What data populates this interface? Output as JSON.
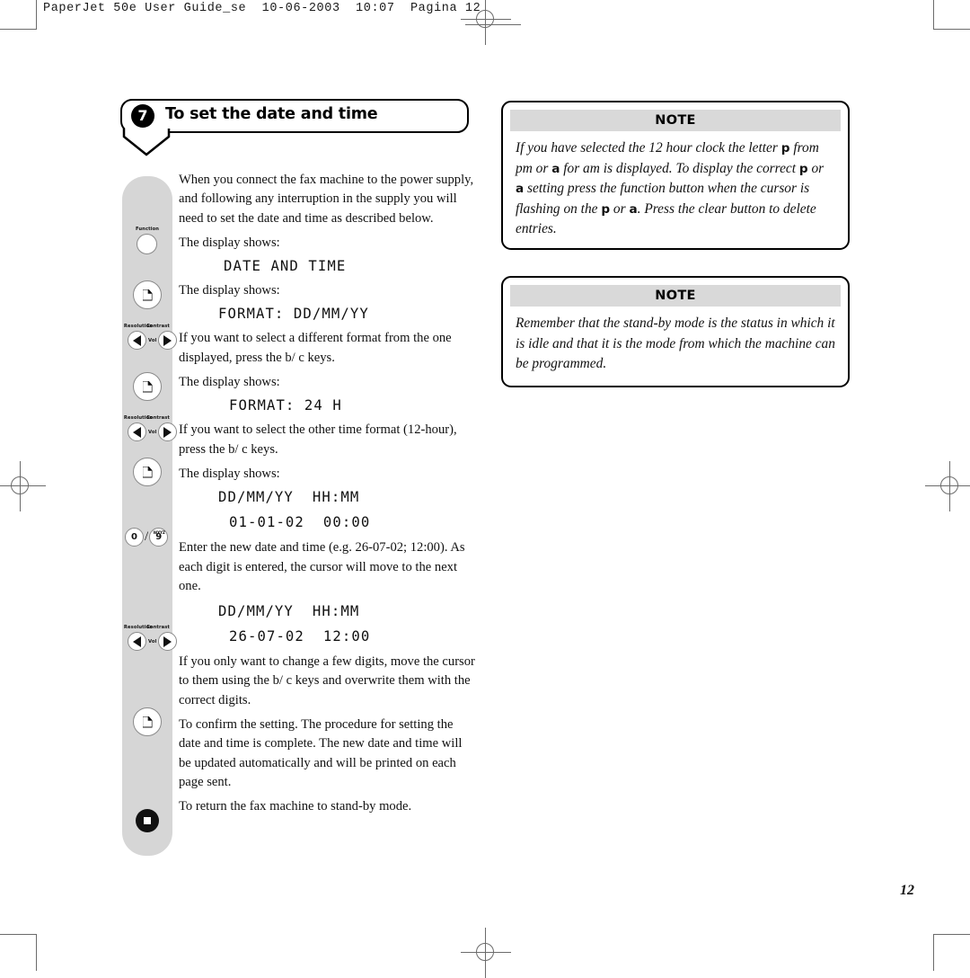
{
  "print_marks": {
    "scan_header": "PaperJet 50e User Guide_se  10-06-2003  10:07  Pagina 12"
  },
  "title": {
    "step_number": "7",
    "heading": "To set the date and time"
  },
  "control_panel": {
    "function_label": "Function",
    "resolution_label": "Resolution",
    "contrast_label": "Contrast",
    "volume_label": "Vol",
    "key_zero": "0",
    "key_nine": "9",
    "key_nine_letters": "WXYZ",
    "separator": "/"
  },
  "body": {
    "intro": "When you connect the fax machine to the power supply, and following any interruption in the supply you will need to set the date and time as described below.",
    "display_shows_1": "The display shows:",
    "lcd_1": "DATE AND TIME",
    "display_shows_2": "The display shows:",
    "lcd_2": "FORMAT: DD/MM/YY",
    "step_format": "If you want to select a different format from the one displayed, press the b/ c keys.",
    "display_shows_3": "The display shows:",
    "lcd_3": "FORMAT: 24 H",
    "step_time_format": "If you want to select the other time format (12-hour), press the b/ c keys.",
    "display_shows_4": "The display shows:",
    "lcd_4a": "DD/MM/YY  HH:MM",
    "lcd_4b": "01-01-02  00:00",
    "step_enter": "Enter the new date and time (e.g. 26-07-02; 12:00). As each digit is entered, the cursor will move to the next one.",
    "lcd_5a": "DD/MM/YY  HH:MM",
    "lcd_5b": "26-07-02  12:00",
    "step_edit": "If you only want to change a few digits, move the cursor to them using the b/ c keys and overwrite them with the correct digits.",
    "step_confirm": "To confirm the setting. The procedure for setting the date and time is complete. The new date and time will be updated automatically and will be printed on each page sent.",
    "step_standby": "To return the fax machine to stand-by mode."
  },
  "notes": [
    {
      "header": "NOTE",
      "segments": [
        {
          "t": "If you have selected the 12 hour clock the letter ",
          "b": false
        },
        {
          "t": "p",
          "b": true
        },
        {
          "t": " from pm or ",
          "b": false
        },
        {
          "t": "a",
          "b": true
        },
        {
          "t": " for am is displayed. To display the correct ",
          "b": false
        },
        {
          "t": "p",
          "b": true
        },
        {
          "t": " or ",
          "b": false
        },
        {
          "t": "a",
          "b": true
        },
        {
          "t": " setting press the function button when the cursor is flashing on the ",
          "b": false
        },
        {
          "t": "p",
          "b": true
        },
        {
          "t": " or ",
          "b": false
        },
        {
          "t": "a",
          "b": true
        },
        {
          "t": ". Press the clear button to delete entries.",
          "b": false
        }
      ]
    },
    {
      "header": "NOTE",
      "segments": [
        {
          "t": "Remember that the stand-by mode is the status in which it is idle and that it is the mode from which the machine can be programmed.",
          "b": false
        }
      ]
    }
  ],
  "folio": "12",
  "colors": {
    "panel_gray": "#d6d6d6",
    "note_header_gray": "#d9d9d9",
    "ink": "#111111",
    "mark_gray": "#6b6b6b"
  }
}
